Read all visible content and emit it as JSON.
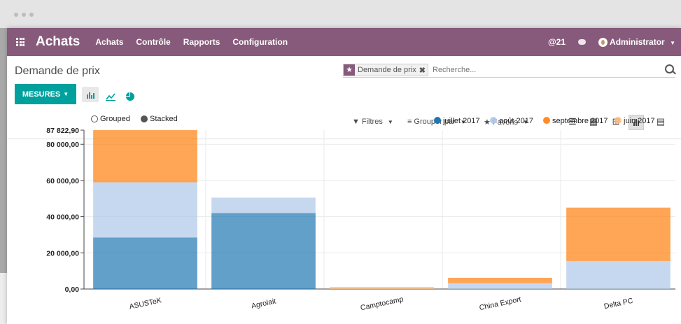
{
  "app": {
    "title": "Achats"
  },
  "menu": [
    "Achats",
    "Contrôle",
    "Rapports",
    "Configuration"
  ],
  "nav_right": {
    "notifications": "@21",
    "user": "Administrator"
  },
  "breadcrumb": "Demande de prix",
  "search": {
    "facet_label": "Demande de prix",
    "placeholder": "Recherche..."
  },
  "toolbar": {
    "mesures_label": "MESURES",
    "filters_label": "Filtres",
    "group_by_label": "Grouper par",
    "favorites_label": "Favoris"
  },
  "chart_options": {
    "grouped_label": "Grouped",
    "stacked_label": "Stacked",
    "selected": "Stacked"
  },
  "colors": {
    "brand": "#875a7b",
    "accent": "#00a09d"
  },
  "chart_data": {
    "type": "bar",
    "stacked": true,
    "categories": [
      "ASUSTeK",
      "Agrolait",
      "Camptocamp",
      "China Export",
      "Delta PC"
    ],
    "series": [
      {
        "name": "juillet 2017",
        "color": "#1f77b4",
        "values": [
          28500,
          42000,
          0,
          0,
          0
        ]
      },
      {
        "name": "août 2017",
        "color": "#aec7e8",
        "values": [
          30500,
          8500,
          0,
          3200,
          15500
        ]
      },
      {
        "name": "septembre 2017",
        "color": "#ff7f0e",
        "values": [
          28822.9,
          0,
          0,
          3000,
          29500
        ]
      },
      {
        "name": "juin 2017",
        "color": "#ffbb78",
        "values": [
          0,
          0,
          1200,
          0,
          0
        ]
      }
    ],
    "ylim": [
      0,
      87822.9
    ],
    "y_ticks": [
      "0,00",
      "20 000,00",
      "40 000,00",
      "60 000,00",
      "80 000,00",
      "87 822,90"
    ],
    "y_tick_values": [
      0,
      20000,
      40000,
      60000,
      80000,
      87822.9
    ],
    "legend_position": "top-right",
    "grid": true
  }
}
